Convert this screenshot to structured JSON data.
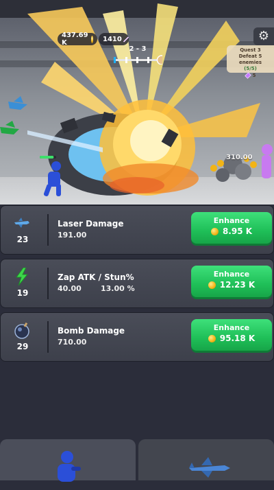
{
  "hud": {
    "coins": "437.69 K",
    "gems": "1410",
    "stage": "2 - 3"
  },
  "quest": {
    "title": "Quest 3",
    "objective": "Defeat 5 enemies",
    "progress": "(5/5)",
    "reward": "5"
  },
  "scene": {
    "floating_number": "310.00",
    "player_health_fraction": 0.85
  },
  "upgrades": [
    {
      "name": "Laser Damage",
      "level": "23",
      "values": [
        "191.00"
      ],
      "button_label": "Enhance",
      "cost": "8.95 K",
      "icon": "laser-plane-icon"
    },
    {
      "name": "Zap ATK / Stun%",
      "level": "19",
      "values": [
        "40.00",
        "13.00 %"
      ],
      "button_label": "Enhance",
      "cost": "12.23 K",
      "icon": "lightning-icon"
    },
    {
      "name": "Bomb Damage",
      "level": "29",
      "values": [
        "710.00"
      ],
      "button_label": "Enhance",
      "cost": "95.18 K",
      "icon": "bomb-icon"
    }
  ],
  "bottom_tabs": [
    {
      "icon": "stickman-hero-icon"
    },
    {
      "icon": "jet-plane-icon"
    }
  ],
  "colors": {
    "enhance_green": "#23c45c",
    "panel_bg": "#2b2d3a",
    "card_bg": "#454854"
  }
}
